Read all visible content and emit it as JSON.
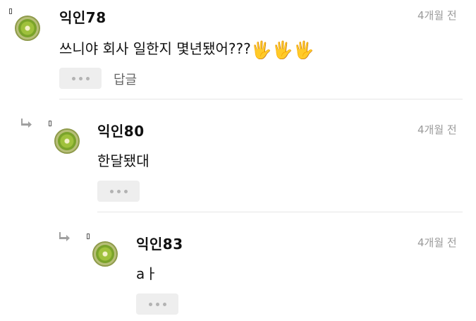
{
  "comments": [
    {
      "author": "익인78",
      "time": "4개월 전",
      "text": "쓰니야 회사 일한지 몇년됐어???",
      "emoji": "🖐🖐🖐",
      "reply_label": "답글"
    },
    {
      "author": "익인80",
      "time": "4개월 전",
      "text": "한달됐대"
    },
    {
      "author": "익인83",
      "time": "4개월 전",
      "text": "aㅏ"
    }
  ],
  "icons": {
    "avatar": "kiwi-avatar-icon",
    "reply_arrow": "reply-arrow-icon",
    "more": "more-dots-icon"
  },
  "colors": {
    "time": "#9a9a9a",
    "more_button_bg": "#eeeeee",
    "divider": "#e6e6e6"
  }
}
